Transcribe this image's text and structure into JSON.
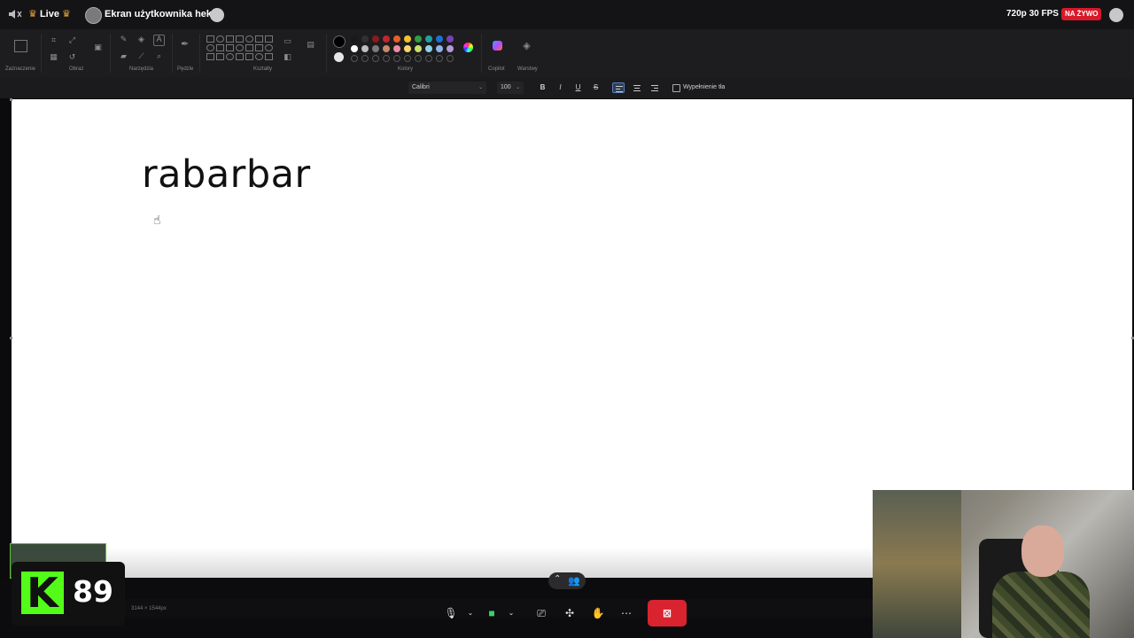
{
  "stream": {
    "live_label": "Live",
    "title": "Ekran użytkownika heksa",
    "quality": "720p 30 FPS",
    "live_badge": "NA ŻYWO"
  },
  "ribbon": {
    "groups": [
      "Zaznaczenie",
      "Obraz",
      "Narzędzia",
      "Pędzle",
      "Kształty",
      "Kolory",
      "Copilot",
      "Warstwy"
    ],
    "colors": [
      "#000000",
      "#1a1a1a",
      "#303030",
      "#8b1a1a",
      "#c1272d",
      "#e85d2a",
      "#f2c230",
      "#2f9e44",
      "#1fa1a1",
      "#1f6fd1",
      "#7b3fb8",
      "#ffffff",
      "#bfbfbf",
      "#7a7a7a",
      "#c58a6a",
      "#f08aa0",
      "#f7d66a",
      "#c9e06a",
      "#8ed1e8",
      "#8fb4e8",
      "#b59ad8"
    ]
  },
  "textbar": {
    "font": "Calibri",
    "size": "100",
    "bold": "B",
    "italic": "I",
    "underline": "U",
    "strike": "S",
    "fill_label": "Wypełnienie tła"
  },
  "canvas": {
    "text": "rabarbar"
  },
  "statusbar": {
    "dimensions": "3144 × 1544px"
  },
  "kick": {
    "letter": "K",
    "viewers": "89"
  },
  "icons": [
    "speaker-icon",
    "crown-icon",
    "chat-icon",
    "microphone-icon",
    "camera-icon",
    "share-screen-icon",
    "apps-icon",
    "reactions-icon",
    "more-icon",
    "end-call-icon",
    "people-icon"
  ]
}
